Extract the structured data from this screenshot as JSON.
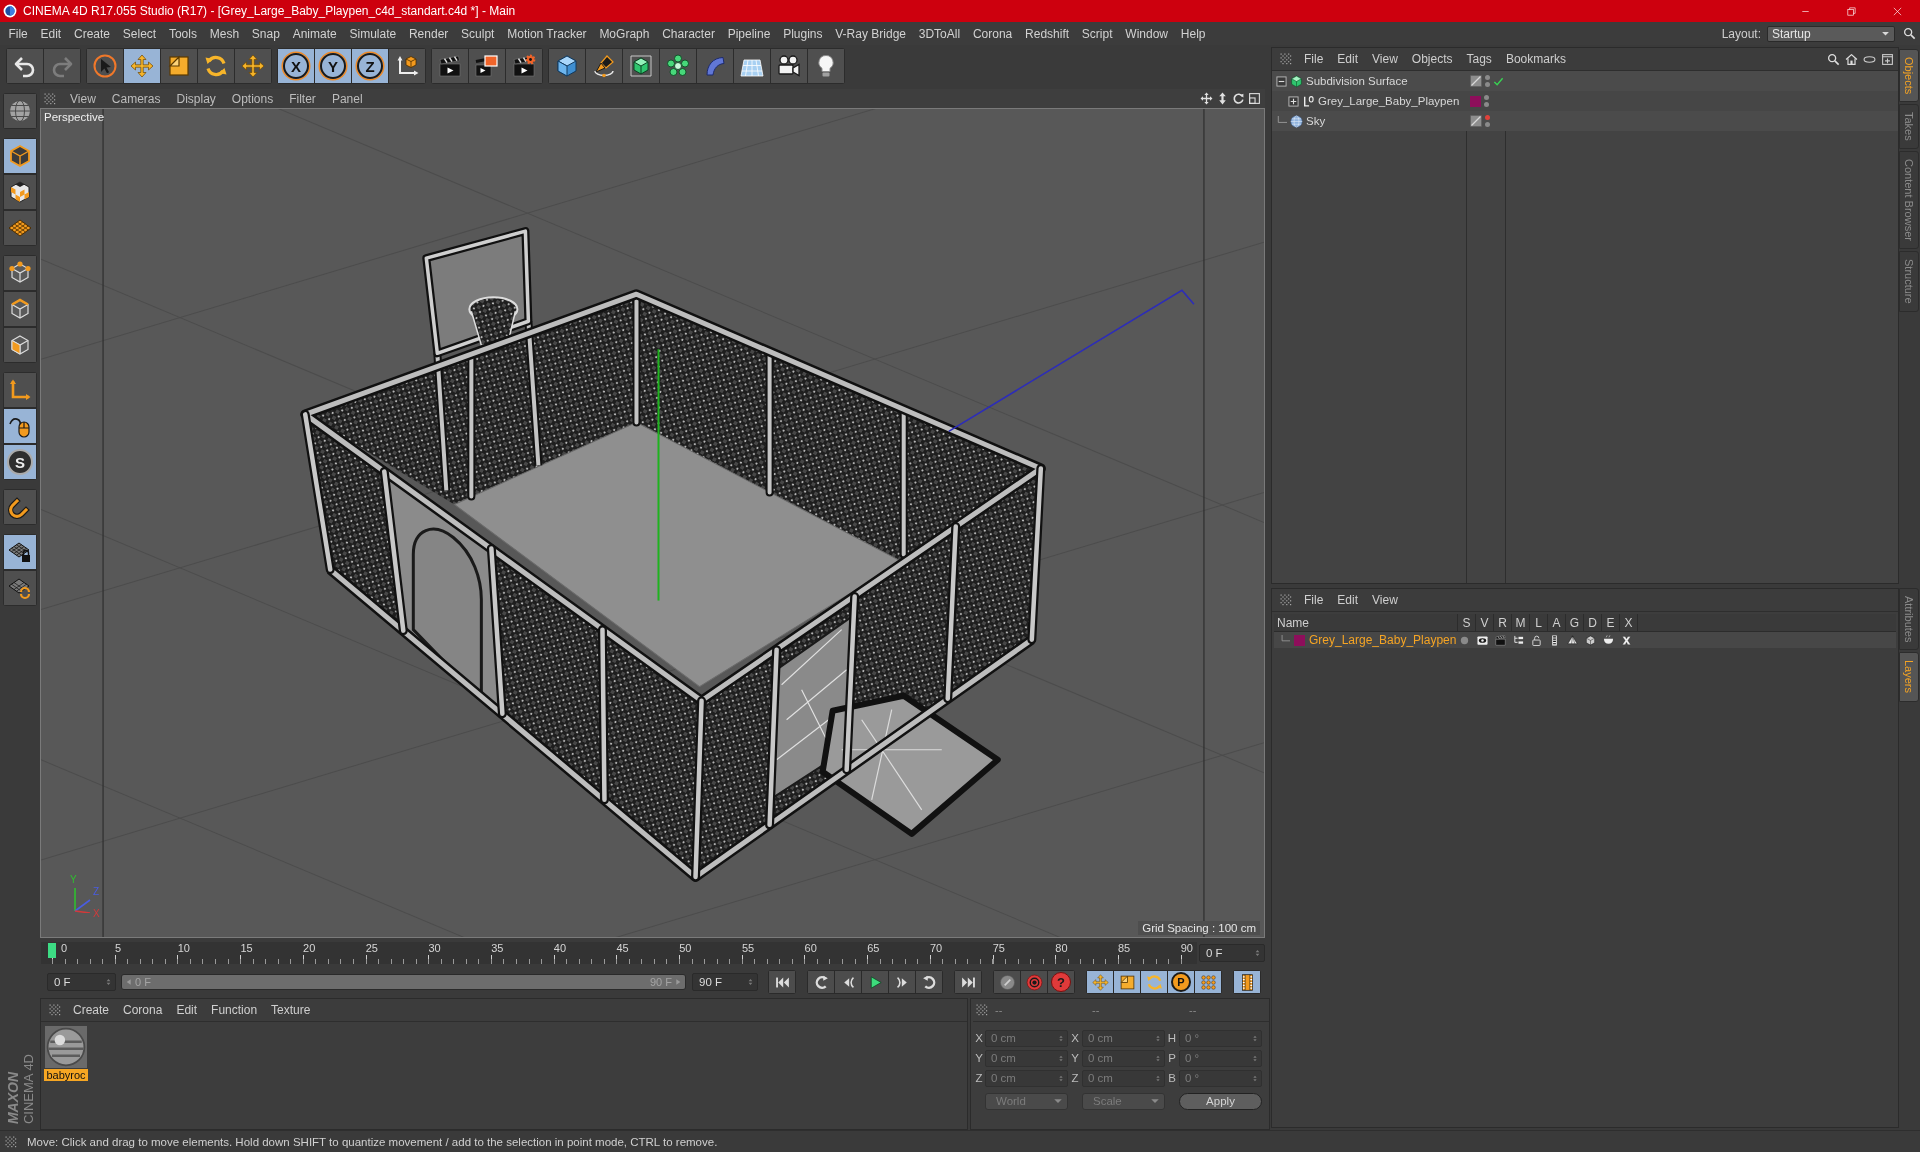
{
  "window": {
    "title": "CINEMA 4D R17.055 Studio (R17) - [Grey_Large_Baby_Playpen_c4d_standart.c4d *] - Main"
  },
  "menu_bar": [
    "File",
    "Edit",
    "Create",
    "Select",
    "Tools",
    "Mesh",
    "Snap",
    "Animate",
    "Simulate",
    "Render",
    "Sculpt",
    "Motion Tracker",
    "MoGraph",
    "Character",
    "Pipeline",
    "Plugins",
    "V-Ray Bridge",
    "3DToAll",
    "Corona",
    "Redshift",
    "Script",
    "Window",
    "Help"
  ],
  "layout": {
    "label": "Layout:",
    "value": "Startup"
  },
  "toolbar": [
    {
      "items": [
        {
          "kind": "undo",
          "disabled": false
        },
        {
          "kind": "redo",
          "disabled": true
        }
      ]
    },
    {
      "items": [
        {
          "kind": "select",
          "selected": false
        },
        {
          "kind": "move",
          "selected": true
        },
        {
          "kind": "scale",
          "selected": false
        },
        {
          "kind": "rotate",
          "selected": false
        },
        {
          "kind": "move-last",
          "selected": false
        }
      ]
    },
    {
      "items": [
        {
          "kind": "axis",
          "label": "X",
          "selected": true
        },
        {
          "kind": "axis",
          "label": "Y",
          "selected": true
        },
        {
          "kind": "axis",
          "label": "Z",
          "selected": true
        },
        {
          "kind": "coords",
          "selected": false
        }
      ]
    },
    {
      "items": [
        {
          "kind": "render-view"
        },
        {
          "kind": "render-viewer"
        },
        {
          "kind": "render-settings"
        }
      ]
    },
    {
      "items": [
        {
          "kind": "cube"
        },
        {
          "kind": "pen"
        },
        {
          "kind": "subdivision"
        },
        {
          "kind": "cloner"
        },
        {
          "kind": "bend"
        },
        {
          "kind": "floor"
        },
        {
          "kind": "camera"
        },
        {
          "kind": "light"
        }
      ]
    }
  ],
  "left_tools": [
    {
      "items": [
        {
          "kind": "globe",
          "selected": false
        }
      ]
    },
    {
      "items": [
        {
          "kind": "model",
          "selected": true
        },
        {
          "kind": "texture",
          "selected": false
        },
        {
          "kind": "workplane",
          "selected": false
        }
      ]
    },
    {
      "items": [
        {
          "kind": "points",
          "selected": false
        },
        {
          "kind": "edges",
          "selected": false
        },
        {
          "kind": "polygons",
          "selected": false
        }
      ]
    },
    {
      "items": [
        {
          "kind": "axis",
          "selected": false
        },
        {
          "kind": "tweak",
          "selected": true
        },
        {
          "kind": "snap",
          "label": "S",
          "selected": true
        }
      ]
    },
    {
      "items": [
        {
          "kind": "magnet",
          "selected": false
        }
      ]
    },
    {
      "items": [
        {
          "kind": "grid-lock",
          "selected": true
        },
        {
          "kind": "grid-sync",
          "selected": false
        }
      ]
    }
  ],
  "viewport": {
    "menu": [
      "View",
      "Cameras",
      "Display",
      "Options",
      "Filter",
      "Panel"
    ],
    "camera": "Perspective",
    "grid_spacing": "Grid Spacing : 100 cm",
    "axes": [
      {
        "kind": "y",
        "label": "Y"
      },
      {
        "kind": "z",
        "label": "Z"
      },
      {
        "kind": "x",
        "label": "X"
      }
    ]
  },
  "timeline": {
    "ticks": [
      "0",
      "5",
      "10",
      "15",
      "20",
      "25",
      "30",
      "35",
      "40",
      "45",
      "50",
      "55",
      "60",
      "65",
      "70",
      "75",
      "80",
      "85",
      "90"
    ],
    "level": 0,
    "frame": "0 F"
  },
  "transport": {
    "start": "0 F",
    "range": {
      "start": "0 F",
      "end": "90 F",
      "level": 1
    },
    "end": "90 F",
    "groups": [
      {
        "items": [
          {
            "kind": "first"
          }
        ]
      },
      {
        "items": [
          {
            "kind": "prev-key"
          },
          {
            "kind": "prev-frame"
          },
          {
            "kind": "play"
          },
          {
            "kind": "next-frame"
          },
          {
            "kind": "next-key"
          }
        ]
      },
      {
        "items": [
          {
            "kind": "last"
          }
        ]
      },
      {
        "items": [
          {
            "kind": "record"
          },
          {
            "kind": "autokey"
          },
          {
            "kind": "key-selection",
            "label": "?"
          }
        ]
      },
      {
        "items": [
          {
            "kind": "key-move",
            "selected": true
          },
          {
            "kind": "key-scale",
            "selected": true
          },
          {
            "kind": "key-rotate",
            "selected": true
          },
          {
            "kind": "key-param",
            "label": "P",
            "selected": true
          },
          {
            "kind": "key-points",
            "selected": true
          }
        ]
      },
      {
        "items": [
          {
            "kind": "timeline",
            "selected": true
          }
        ]
      }
    ]
  },
  "materials": {
    "menu": [
      "Create",
      "Corona",
      "Edit",
      "Function",
      "Texture"
    ],
    "items": [
      {
        "name": "babyroc",
        "selected": true
      }
    ]
  },
  "coordinates": {
    "headers": [
      "--",
      "--",
      "--"
    ],
    "rows": [
      [
        {
          "axis": "X",
          "value": "0 cm"
        },
        {
          "axis": "X",
          "value": "0 cm"
        },
        {
          "axis": "H",
          "value": "0 °"
        }
      ],
      [
        {
          "axis": "Y",
          "value": "0 cm"
        },
        {
          "axis": "Y",
          "value": "0 cm"
        },
        {
          "axis": "P",
          "value": "0 °"
        }
      ],
      [
        {
          "axis": "Z",
          "value": "0 cm"
        },
        {
          "axis": "Z",
          "value": "0 cm"
        },
        {
          "axis": "B",
          "value": "0 °"
        }
      ]
    ],
    "dropdowns": [
      "World",
      "Scale"
    ],
    "apply": "Apply"
  },
  "objects": {
    "menu": [
      "File",
      "Edit",
      "View",
      "Objects",
      "Tags",
      "Bookmarks"
    ],
    "items": [
      {
        "name": "Subdivision Surface",
        "kind": "subdivision",
        "expanded": true,
        "enabled": true,
        "editor_off": false,
        "render_off": false,
        "children": [
          {
            "name": "Grey_Large_Baby_Playpen",
            "kind": "null",
            "expanded": false,
            "color": "#8e0e5b",
            "editor_off": false,
            "render_off": false
          }
        ]
      },
      {
        "name": "Sky",
        "kind": "sky",
        "editor_off": true,
        "render_off": false
      }
    ]
  },
  "layers": {
    "menu": [
      "File",
      "Edit",
      "View"
    ],
    "columns": [
      "Name",
      "S",
      "V",
      "R",
      "M",
      "L",
      "A",
      "G",
      "D",
      "E",
      "X"
    ],
    "items": [
      {
        "name": "Grey_Large_Baby_Playpen",
        "color": "#8e0e5b"
      }
    ]
  },
  "side_tabs": [
    {
      "label": "Objects",
      "selected": true
    },
    {
      "label": "Takes",
      "selected": false
    },
    {
      "label": "Content Browser",
      "selected": false
    },
    {
      "label": "Structure",
      "selected": false
    }
  ],
  "side_tabs_lower": [
    {
      "label": "Attributes",
      "selected": false
    },
    {
      "label": "Layers",
      "selected": true
    }
  ],
  "logo": {
    "brand": "MAXON",
    "product": "CINEMA 4D"
  },
  "status_bar": "Move: Click and drag to move elements. Hold down SHIFT to quantize movement / add to the selection in point mode, CTRL to remove."
}
